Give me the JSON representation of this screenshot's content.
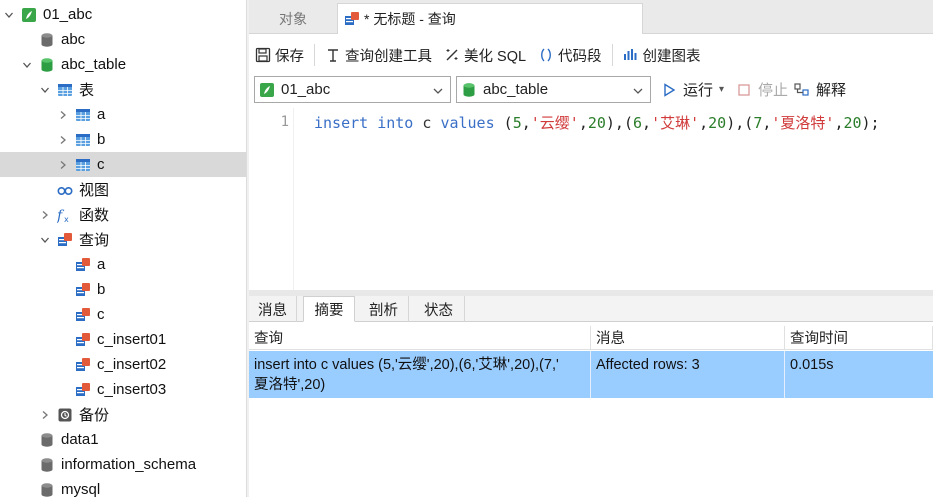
{
  "sidebar": {
    "items": [
      {
        "label": "01_abc",
        "icon": "connection-icon",
        "expanded": true
      },
      {
        "label": "abc",
        "icon": "database-gray-icon"
      },
      {
        "label": "abc_table",
        "icon": "database-green-icon",
        "expanded": true
      },
      {
        "label": "表",
        "icon": "tables-folder-icon",
        "expanded": true
      },
      {
        "label": "a",
        "icon": "table-icon"
      },
      {
        "label": "b",
        "icon": "table-icon"
      },
      {
        "label": "c",
        "icon": "table-icon",
        "selected": true
      },
      {
        "label": "视图",
        "icon": "views-icon"
      },
      {
        "label": "函数",
        "icon": "function-icon"
      },
      {
        "label": "查询",
        "icon": "queries-folder-icon",
        "expanded": true
      },
      {
        "label": "a",
        "icon": "query-icon"
      },
      {
        "label": "b",
        "icon": "query-icon"
      },
      {
        "label": "c",
        "icon": "query-icon"
      },
      {
        "label": "c_insert01",
        "icon": "query-icon"
      },
      {
        "label": "c_insert02",
        "icon": "query-icon"
      },
      {
        "label": "c_insert03",
        "icon": "query-icon"
      },
      {
        "label": "备份",
        "icon": "backup-icon"
      },
      {
        "label": "data1",
        "icon": "database-gray-icon"
      },
      {
        "label": "information_schema",
        "icon": "database-gray-icon"
      },
      {
        "label": "mysql",
        "icon": "database-gray-icon"
      }
    ]
  },
  "tabs": {
    "objects": "对象",
    "query": "* 无标题 - 查询"
  },
  "toolbar": {
    "save": "保存",
    "query_builder": "查询创建工具",
    "beautify": "美化 SQL",
    "snippet": "代码段",
    "create_chart": "创建图表"
  },
  "selectors": {
    "connection": "01_abc",
    "database": "abc_table",
    "run": "运行",
    "stop": "停止",
    "explain": "解释"
  },
  "editor": {
    "line_number": "1",
    "tokens": [
      {
        "t": "insert",
        "c": "kw"
      },
      {
        "t": " ",
        "c": "pn"
      },
      {
        "t": "into",
        "c": "kw"
      },
      {
        "t": " c ",
        "c": "id"
      },
      {
        "t": "values",
        "c": "kw"
      },
      {
        "t": " (",
        "c": "pn"
      },
      {
        "t": "5",
        "c": "num"
      },
      {
        "t": ",",
        "c": "pn"
      },
      {
        "t": "'云缨'",
        "c": "str"
      },
      {
        "t": ",",
        "c": "pn"
      },
      {
        "t": "20",
        "c": "num"
      },
      {
        "t": "),(",
        "c": "pn"
      },
      {
        "t": "6",
        "c": "num"
      },
      {
        "t": ",",
        "c": "pn"
      },
      {
        "t": "'艾琳'",
        "c": "str"
      },
      {
        "t": ",",
        "c": "pn"
      },
      {
        "t": "20",
        "c": "num"
      },
      {
        "t": "),(",
        "c": "pn"
      },
      {
        "t": "7",
        "c": "num"
      },
      {
        "t": ",",
        "c": "pn"
      },
      {
        "t": "'夏洛特'",
        "c": "str"
      },
      {
        "t": ",",
        "c": "pn"
      },
      {
        "t": "20",
        "c": "num"
      },
      {
        "t": ");",
        "c": "pn"
      }
    ]
  },
  "result_tabs": [
    "消息",
    "摘要",
    "剖析",
    "状态"
  ],
  "result_active_tab": "摘要",
  "grid": {
    "headers": [
      "查询",
      "消息",
      "查询时间"
    ],
    "row": {
      "query_line1": "insert into c values (5,'云缨',20),(6,'艾琳',20),(7,'",
      "query_line2": "夏洛特',20)",
      "message": "Affected rows: 3",
      "time": "0.015s"
    }
  },
  "colors": {
    "selected_row": "#99ccff",
    "keyword": "#3a6fc7",
    "string": "#d13a3a",
    "number": "#2a7d2a"
  }
}
